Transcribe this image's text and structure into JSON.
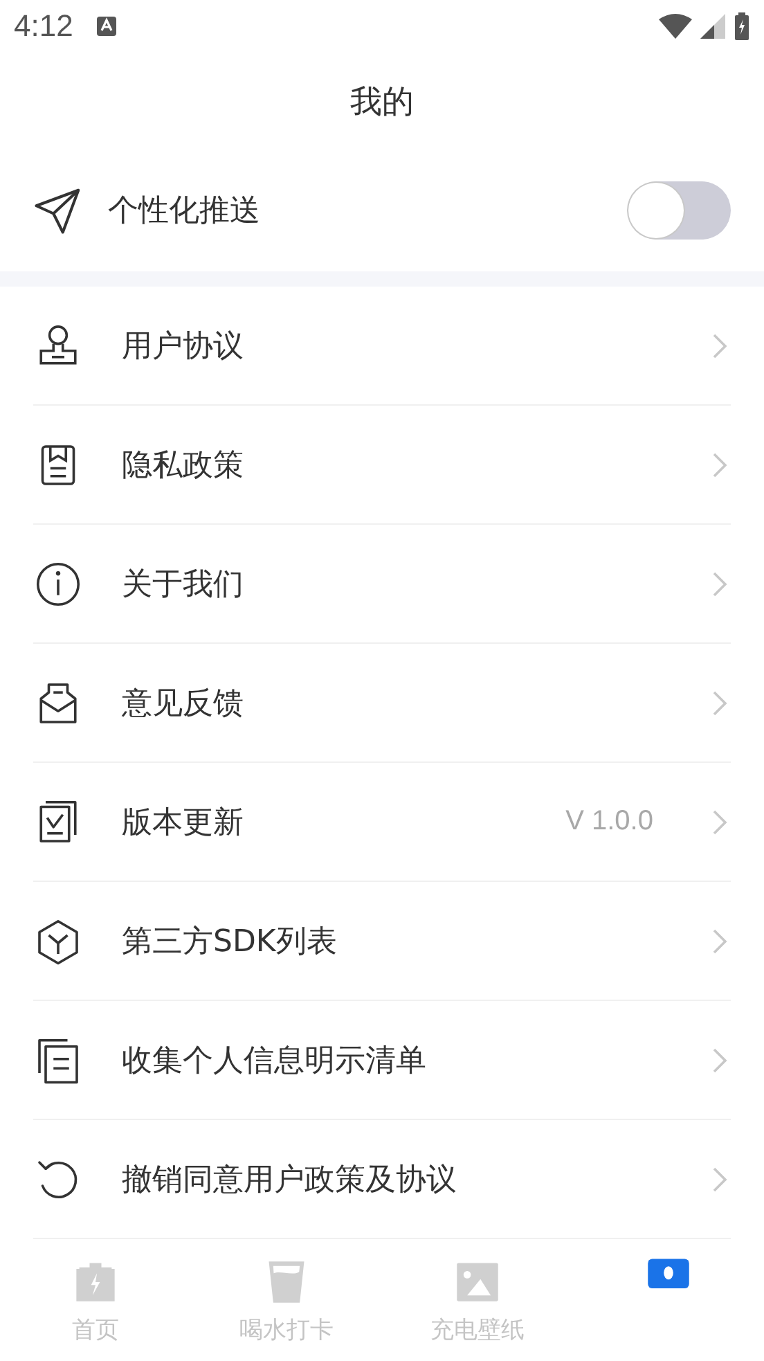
{
  "status_bar": {
    "time": "4:12"
  },
  "header": {
    "title": "我的"
  },
  "push_setting": {
    "label": "个性化推送",
    "on": false
  },
  "menu": [
    {
      "label": "用户协议"
    },
    {
      "label": "隐私政策"
    },
    {
      "label": "关于我们"
    },
    {
      "label": "意见反馈"
    },
    {
      "label": "版本更新",
      "value": "V 1.0.0"
    },
    {
      "label": "第三方SDK列表"
    },
    {
      "label": "收集个人信息明示清单"
    },
    {
      "label": "撤销同意用户政策及协议"
    }
  ],
  "tab_bar": [
    {
      "label": "首页",
      "selected": false
    },
    {
      "label": "喝水打卡",
      "selected": false
    },
    {
      "label": "充电壁纸",
      "selected": false
    },
    {
      "selected": true
    }
  ]
}
